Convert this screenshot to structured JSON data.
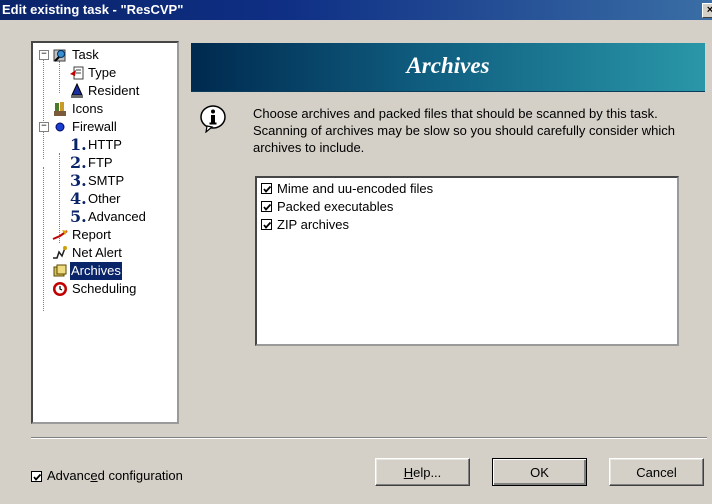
{
  "window": {
    "title": "Edit existing task - \"ResCVP\"",
    "close_glyph": "×"
  },
  "tree": {
    "items": [
      {
        "label": "Task",
        "icon": "task-icon"
      },
      {
        "label": "Type",
        "icon": "type-icon"
      },
      {
        "label": "Resident",
        "icon": "resident-icon"
      },
      {
        "label": "Icons",
        "icon": "icons-icon"
      },
      {
        "label": "Firewall",
        "icon": "firewall-icon"
      },
      {
        "label": "HTTP",
        "num": "1."
      },
      {
        "label": "FTP",
        "num": "2."
      },
      {
        "label": "SMTP",
        "num": "3."
      },
      {
        "label": "Other",
        "num": "4."
      },
      {
        "label": "Advanced",
        "num": "5."
      },
      {
        "label": "Report",
        "icon": "report-icon"
      },
      {
        "label": "Net Alert",
        "icon": "net-alert-icon"
      },
      {
        "label": "Archives",
        "icon": "archives-icon",
        "selected": true
      },
      {
        "label": "Scheduling",
        "icon": "scheduling-icon"
      }
    ]
  },
  "panel": {
    "title": "Archives",
    "description": "Choose archives and packed files that should be scanned by this task. Scanning of archives may be slow so you should carefully consider which archives to include."
  },
  "archives_list": {
    "items": [
      {
        "label": "Mime and uu-encoded files",
        "checked": true
      },
      {
        "label": "Packed executables",
        "checked": true
      },
      {
        "label": "ZIP archives",
        "checked": true
      }
    ]
  },
  "advanced_config": {
    "label_pre": "Advanc",
    "label_accel": "e",
    "label_post": "d configuration",
    "checked": true
  },
  "buttons": {
    "help": {
      "accel": "H",
      "rest": "elp..."
    },
    "ok": "OK",
    "cancel": "Cancel"
  },
  "colors": {
    "header_start": "#00294f",
    "header_end": "#2a97a8",
    "title_bar": "#0a246a",
    "selection": "#0a246a"
  }
}
